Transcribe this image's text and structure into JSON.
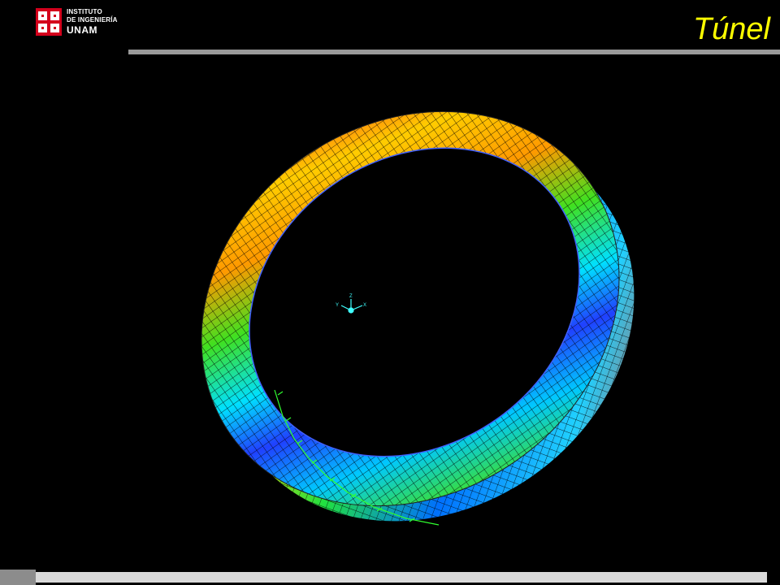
{
  "header": {
    "logo": {
      "line1": "INSTITUTO",
      "line2": "DE INGENIERÍA",
      "line3": "UNAM",
      "colors": {
        "red": "#d4001c",
        "white": "#ffffff"
      }
    },
    "title": "Túnel",
    "title_color": "#ffff00"
  },
  "scene": {
    "background": "#000000",
    "axis_labels": [
      "Z",
      "Y",
      "X"
    ]
  }
}
